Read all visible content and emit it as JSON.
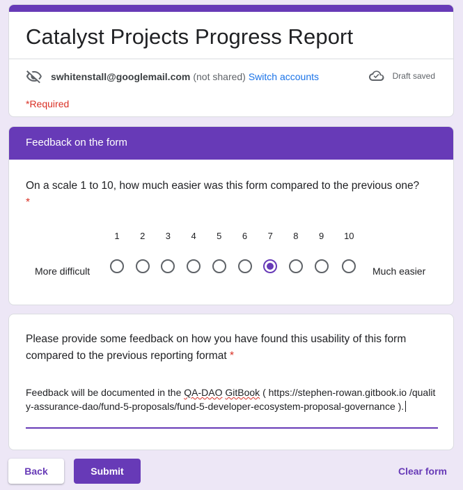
{
  "form": {
    "title": "Catalyst Projects Progress Report",
    "accent_color": "#673ab7",
    "account": {
      "email": "swhitenstall@googlemail.com",
      "shared_note": "(not shared)",
      "switch_label": "Switch accounts",
      "draft_status": "Draft saved"
    },
    "required_note": "*Required"
  },
  "section": {
    "title": "Feedback on the form",
    "question": {
      "text": "On a scale 1 to 10, how much easier was this form compared to the previous one?",
      "required_mark": "*",
      "scale_numbers": [
        "1",
        "2",
        "3",
        "4",
        "5",
        "6",
        "7",
        "8",
        "9",
        "10"
      ],
      "selected_value": 7,
      "low_label": "More difficult",
      "high_label": "Much easier"
    }
  },
  "feedback": {
    "question": "Please provide some feedback on how you have found this usability of this form compared to the previous reporting format",
    "required_mark": "*",
    "answer_prefix": "Feedback will be documented in the ",
    "answer_misspelled_1": "QA-DAO",
    "answer_space": " ",
    "answer_misspelled_2": "GitBook",
    "answer_suffix": " ( https://stephen-rowan.gitbook.io /quality-assurance-dao/fund-5-proposals/fund-5-developer-ecosystem-proposal-governance )."
  },
  "footer": {
    "back_label": "Back",
    "submit_label": "Submit",
    "clear_label": "Clear form"
  }
}
